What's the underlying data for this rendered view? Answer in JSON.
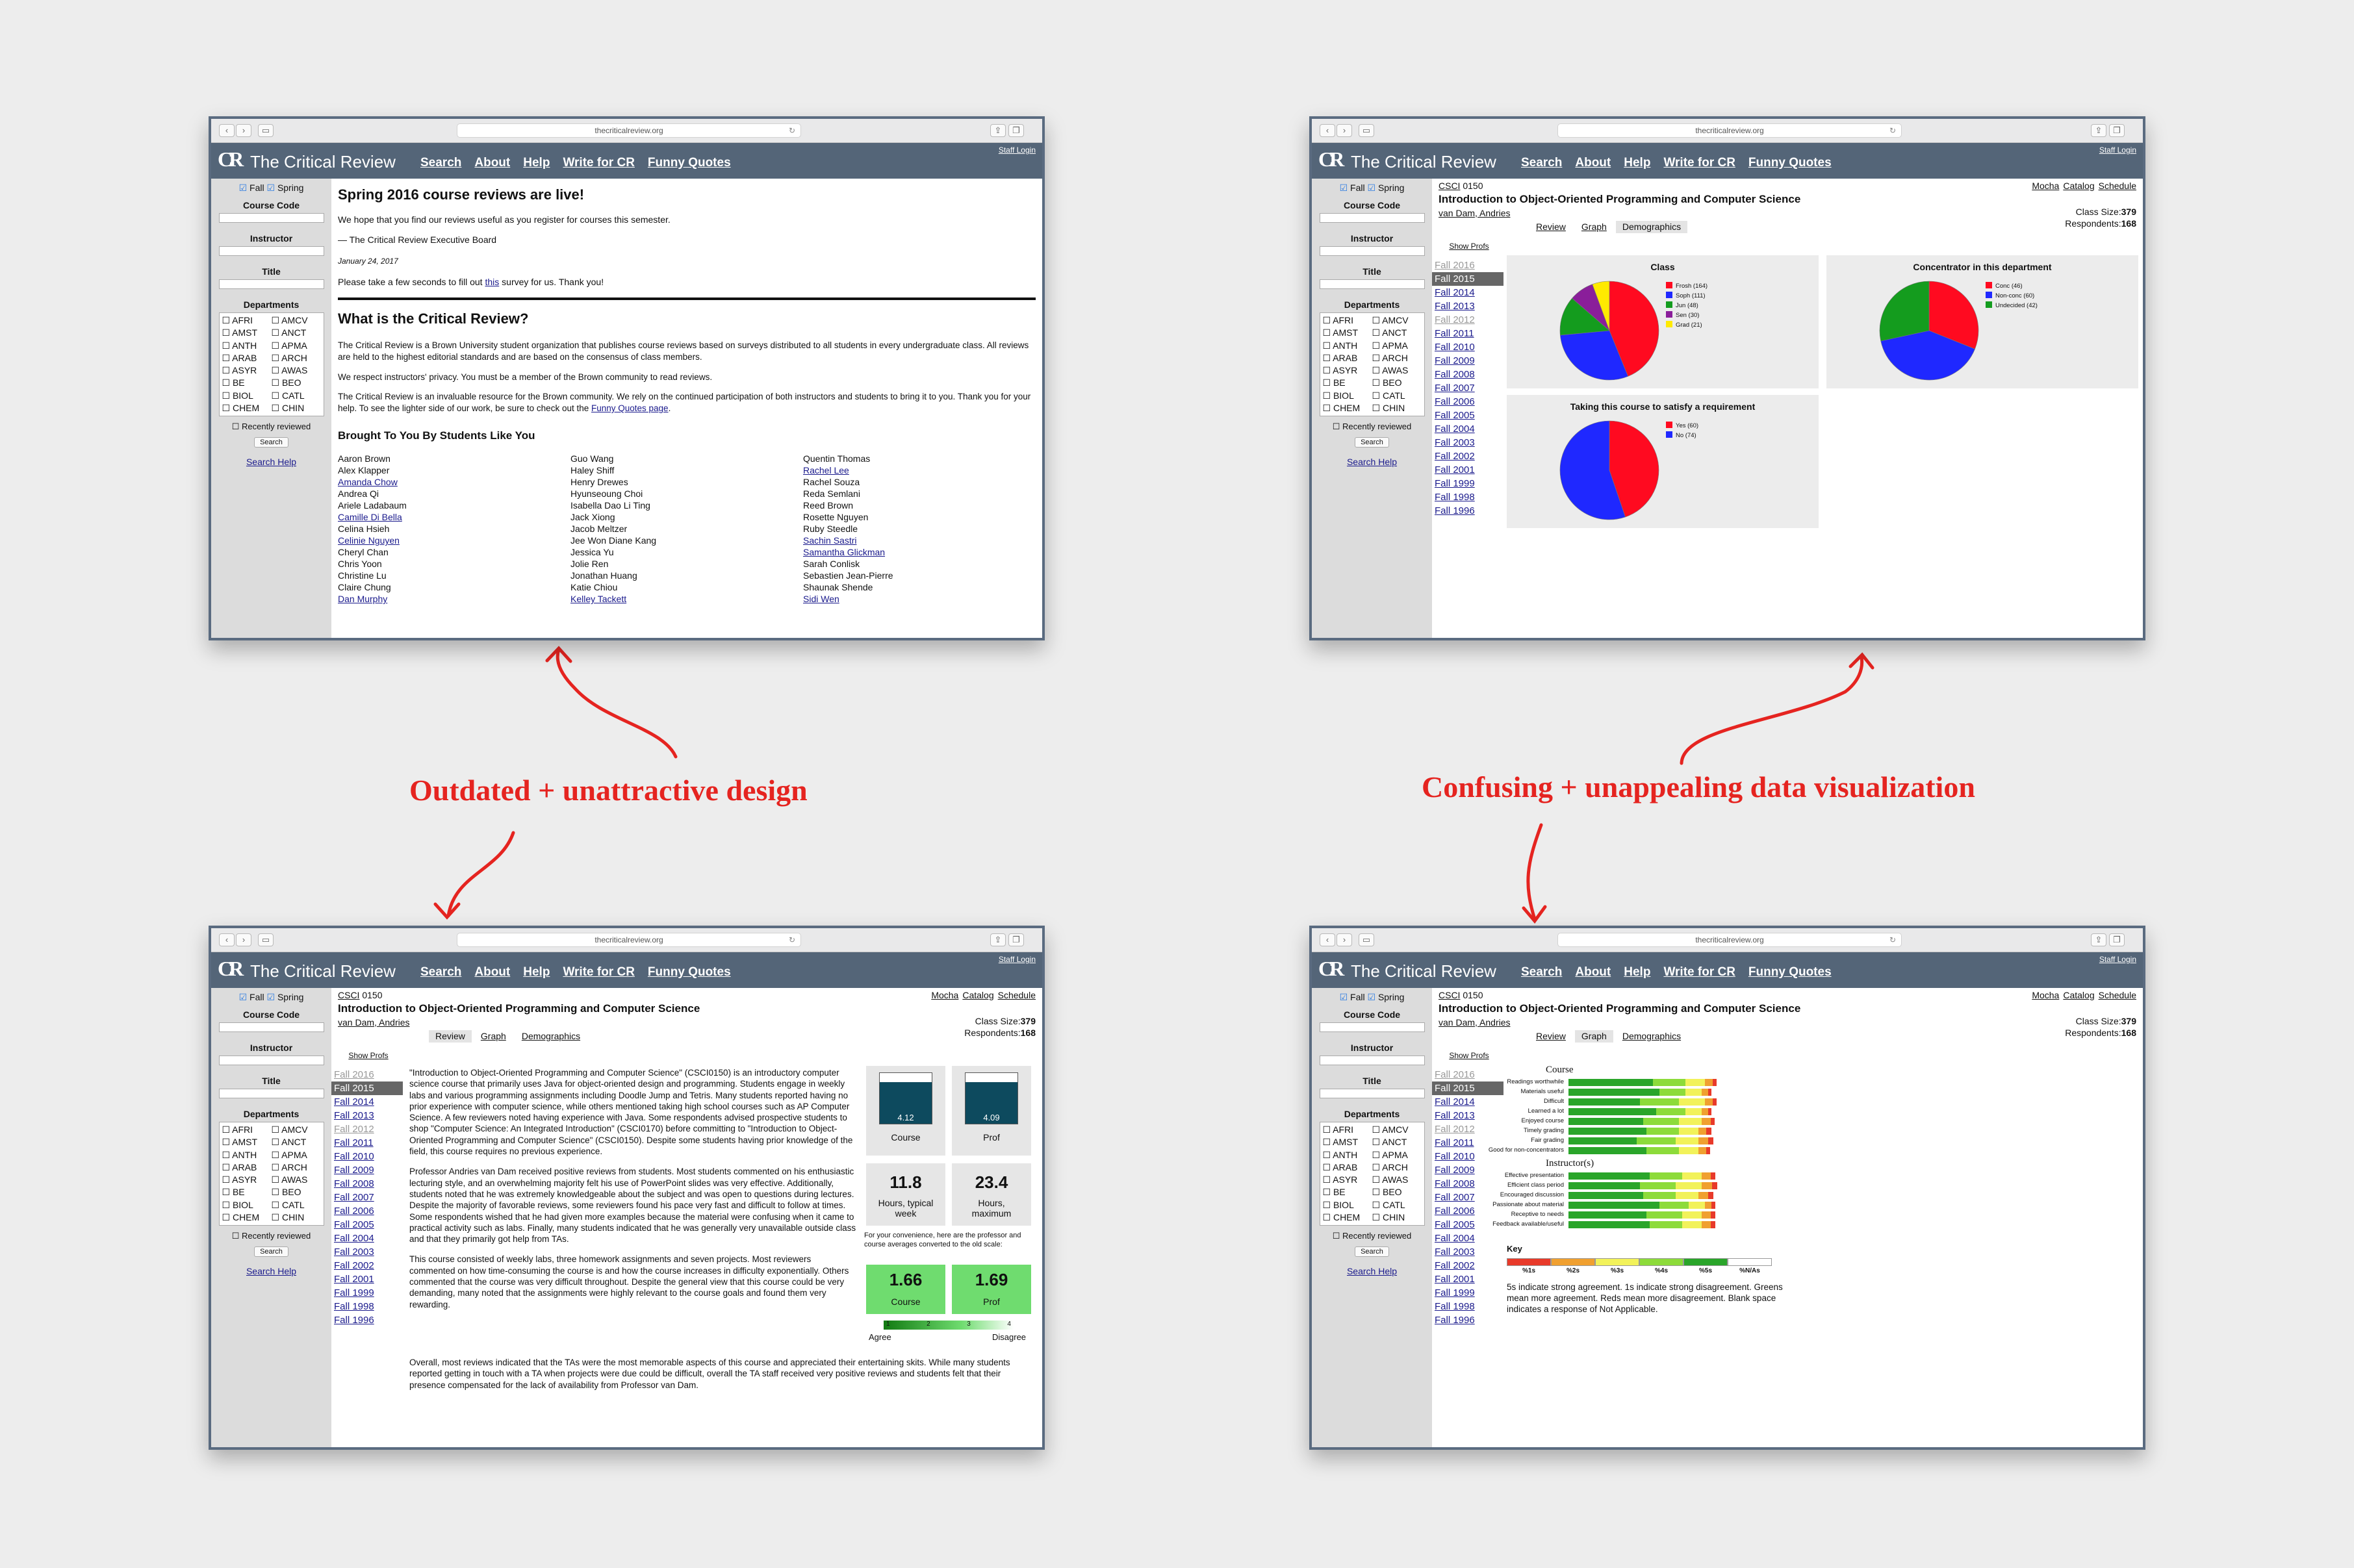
{
  "site": {
    "url": "thecriticalreview.org",
    "logo": "CR",
    "name": "The Critical Review",
    "nav": [
      "Search",
      "About",
      "Help",
      "Write for CR",
      "Funny Quotes"
    ],
    "staff_login": "Staff Login"
  },
  "sidebar": {
    "fall": "Fall",
    "spring": "Spring",
    "course_code": "Course Code",
    "instructor": "Instructor",
    "title": "Title",
    "departments_label": "Departments",
    "departments": [
      "AFRI",
      "AMCV",
      "AMST",
      "ANCT",
      "ANTH",
      "APMA",
      "ARAB",
      "ARCH",
      "ASYR",
      "AWAS",
      "BE",
      "BEO",
      "BIOL",
      "CATL",
      "CHEM",
      "CHIN"
    ],
    "recently_reviewed": "Recently reviewed",
    "search_button": "Search",
    "search_help": "Search Help"
  },
  "home": {
    "headline": "Spring 2016 course reviews are live!",
    "intro": "We hope that you find our reviews useful as you register for courses this semester.",
    "signoff": "— The Critical Review Executive Board",
    "date": "January 24, 2017",
    "survey_pre": "Please take a few seconds to fill out ",
    "survey_link": "this",
    "survey_post": " survey for us. Thank you!",
    "what_title": "What is the Critical Review?",
    "what_p1": "The Critical Review is a Brown University student organization that publishes course reviews based on surveys distributed to all students in every undergraduate class. All reviews are held to the highest editorial standards and are based on the consensus of class members.",
    "what_p2": "We respect instructors' privacy. You must be a member of the Brown community to read reviews.",
    "what_p3_pre": "The Critical Review is an invaluable resource for the Brown community. We rely on the continued participation of both instructors and students to bring it to you. Thank you for your help. To see the lighter side of our work, be sure to check out the ",
    "what_p3_link": "Funny Quotes page",
    "what_p3_post": ".",
    "brought_title": "Brought To You By Students Like You",
    "names": [
      [
        "Aaron Brown",
        "Alex Klapper",
        "Amanda Chow",
        "Andrea Qi",
        "Ariele Ladabaum",
        "Camille Di Bella",
        "Celina Hsieh",
        "Celinie Nguyen",
        "Cheryl Chan",
        "Chris Yoon",
        "Christine Lu",
        "Claire Chung",
        "Dan Murphy"
      ],
      [
        "Guo Wang",
        "Haley Shiff",
        "Henry Drewes",
        "Hyunseoung Choi",
        "Isabella Dao Li Ting",
        "Jack Xiong",
        "Jacob Meltzer",
        "Jee Won Diane Kang",
        "Jessica Yu",
        "Jolie Ren",
        "Jonathan Huang",
        "Katie Chiou",
        "Kelley Tackett"
      ],
      [
        "Quentin Thomas",
        "Rachel Lee",
        "Rachel Souza",
        "Reda Semlani",
        "Reed Brown",
        "Rosette Nguyen",
        "Ruby Steedle",
        "Sachin Sastri",
        "Samantha Glickman",
        "Sarah Conlisk",
        "Sebastien Jean-Pierre",
        "Shaunak Shende",
        "Sidi Wen"
      ]
    ]
  },
  "course": {
    "dept": "CSCI",
    "number": "0150",
    "title": "Introduction to Object-Oriented Programming and Computer Science",
    "instructor": "van Dam, Andries",
    "links": [
      "Mocha",
      "Catalog",
      "Schedule"
    ],
    "class_size_label": "Class Size:",
    "class_size": "379",
    "respondents_label": "Respondents:",
    "respondents": "168",
    "tabs": [
      "Review",
      "Graph",
      "Demographics"
    ],
    "show_profs": "Show Profs",
    "years": [
      "Fall 2016",
      "Fall 2015",
      "Fall 2014",
      "Fall 2013",
      "Fall 2012",
      "Fall 2011",
      "Fall 2010",
      "Fall 2009",
      "Fall 2008",
      "Fall 2007",
      "Fall 2006",
      "Fall 2005",
      "Fall 2004",
      "Fall 2003",
      "Fall 2002",
      "Fall 2001",
      "Fall 1999",
      "Fall 1998",
      "Fall 1996"
    ]
  },
  "demographics": {
    "class_title": "Class",
    "concentrator_title": "Concentrator in this department",
    "requirement_title": "Taking this course to satisfy a requirement"
  },
  "review": {
    "p1": "\"Introduction to Object-Oriented Programming and Computer Science\" (CSCI0150) is an introductory computer science course that primarily uses Java for object-oriented design and programming. Students engage in weekly labs and various programming assignments including Doodle Jump and Tetris. Many students reported having no prior experience with computer science, while others mentioned taking high school courses such as AP Computer Science. A few reviewers noted having experience with Java. Some respondents advised prospective students to shop \"Computer Science: An Integrated Introduction\" (CSCI0170) before committing to \"Introduction to Object-Oriented Programming and Computer Science\" (CSCI0150). Despite some students having prior knowledge of the field, this course requires no previous experience.",
    "p2": "Professor Andries van Dam received positive reviews from students. Most students commented on his enthusiastic lecturing style, and an overwhelming majority felt his use of PowerPoint slides was very effective. Additionally, students noted that he was extremely knowledgeable about the subject and was open to questions during lectures. Despite the majority of favorable reviews, some reviewers found his pace very fast and difficult to follow at times. Some respondents wished that he had given more examples because the material were confusing when it came to practical activity such as labs. Finally, many students indicated that he was generally very unavailable outside class and that they primarily got help from TAs.",
    "p3": "This course consisted of weekly labs, three homework assignments and seven projects. Most reviewers commented on how time-consuming the course is and how the course increases in difficulty exponentially. Others commented that the course was very difficult throughout. Despite the general view that this course could be very demanding, many noted that the assignments were highly relevant to the course goals and found them very rewarding.",
    "p4": "Overall, most reviews indicated that the TAs were the most memorable aspects of this course and appreciated their entertaining skits. While many students reported getting in touch with a TA when projects were due could be difficult, overall the TA staff received very positive reviews and students felt that their presence compensated for the lack of availability from Professor van Dam.",
    "course_score": "4.12",
    "course_label": "Course",
    "prof_score": "4.09",
    "prof_label": "Prof",
    "hours_typical": "11.8",
    "hours_typical_label": "Hours, typical week",
    "hours_max": "23.4",
    "hours_max_label": "Hours, maximum",
    "convenience_note": "For your convenience, here are the professor and course averages converted to the old scale:",
    "old_course": "1.66",
    "old_prof": "1.69",
    "scale_ticks": [
      "1",
      "2",
      "3",
      "4"
    ],
    "agree": "Agree",
    "disagree": "Disagree"
  },
  "graph": {
    "course_heading": "Course",
    "course_items": [
      "Readings worthwhile",
      "Materials useful",
      "Difficult",
      "Learned a lot",
      "Enjoyed course",
      "Timely grading",
      "Fair grading",
      "Good for non-concentrators"
    ],
    "instructor_heading": "Instructor(s)",
    "instructor_items": [
      "Effective presentation",
      "Efficient class period",
      "Encouraged discussion",
      "Passionate about material",
      "Receptive to needs",
      "Feedback available/useful"
    ],
    "key_label": "Key",
    "key_items": [
      "%1s",
      "%2s",
      "%3s",
      "%4s",
      "%5s",
      "%N/As"
    ],
    "key_text": "5s indicate strong agreement. 1s indicate strong disagreement. Greens mean more agreement. Reds mean more disagreement. Blank space indicates a response of Not Applicable."
  },
  "annotations": {
    "left": "Outdated + unattractive design",
    "right": "Confusing + unappealing data visualization"
  },
  "colors": {
    "header": "#546578",
    "annotation": "#e52420",
    "score_box": "#0d4a5e",
    "old_scale": "#6fdc6f"
  },
  "chart_data": [
    {
      "type": "pie",
      "title": "Class",
      "categories": [
        "Frosh (164)",
        "Soph (111)",
        "Jun (48)",
        "Sen (30)",
        "Grad (21)"
      ],
      "values": [
        164,
        111,
        48,
        30,
        21
      ],
      "colors": [
        "#ff0a20",
        "#1f28ff",
        "#149c1e",
        "#8a1e9a",
        "#ffea00"
      ]
    },
    {
      "type": "pie",
      "title": "Concentrator in this department",
      "categories": [
        "Conc (46)",
        "Non-conc (60)",
        "Undecided (42)"
      ],
      "values": [
        46,
        60,
        42
      ],
      "colors": [
        "#ff0a20",
        "#1f28ff",
        "#149c1e"
      ]
    },
    {
      "type": "pie",
      "title": "Taking this course to satisfy a requirement",
      "categories": [
        "Yes (60)",
        "No (74)"
      ],
      "values": [
        60,
        74
      ],
      "colors": [
        "#ff0a20",
        "#1f28ff"
      ]
    }
  ]
}
